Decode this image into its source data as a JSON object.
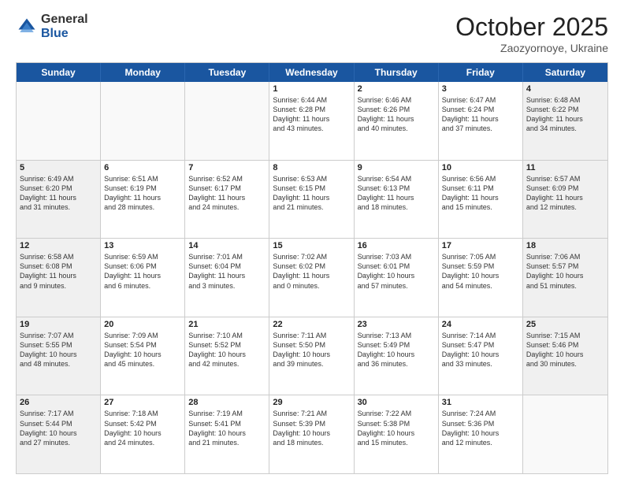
{
  "header": {
    "logo_general": "General",
    "logo_blue": "Blue",
    "month_title": "October 2025",
    "subtitle": "Zaozyornoye, Ukraine"
  },
  "days_of_week": [
    "Sunday",
    "Monday",
    "Tuesday",
    "Wednesday",
    "Thursday",
    "Friday",
    "Saturday"
  ],
  "weeks": [
    [
      {
        "day": "",
        "info": "",
        "empty": true
      },
      {
        "day": "",
        "info": "",
        "empty": true
      },
      {
        "day": "",
        "info": "",
        "empty": true
      },
      {
        "day": "1",
        "info": "Sunrise: 6:44 AM\nSunset: 6:28 PM\nDaylight: 11 hours\nand 43 minutes."
      },
      {
        "day": "2",
        "info": "Sunrise: 6:46 AM\nSunset: 6:26 PM\nDaylight: 11 hours\nand 40 minutes."
      },
      {
        "day": "3",
        "info": "Sunrise: 6:47 AM\nSunset: 6:24 PM\nDaylight: 11 hours\nand 37 minutes."
      },
      {
        "day": "4",
        "info": "Sunrise: 6:48 AM\nSunset: 6:22 PM\nDaylight: 11 hours\nand 34 minutes.",
        "shaded": true
      }
    ],
    [
      {
        "day": "5",
        "info": "Sunrise: 6:49 AM\nSunset: 6:20 PM\nDaylight: 11 hours\nand 31 minutes.",
        "shaded": true
      },
      {
        "day": "6",
        "info": "Sunrise: 6:51 AM\nSunset: 6:19 PM\nDaylight: 11 hours\nand 28 minutes."
      },
      {
        "day": "7",
        "info": "Sunrise: 6:52 AM\nSunset: 6:17 PM\nDaylight: 11 hours\nand 24 minutes."
      },
      {
        "day": "8",
        "info": "Sunrise: 6:53 AM\nSunset: 6:15 PM\nDaylight: 11 hours\nand 21 minutes."
      },
      {
        "day": "9",
        "info": "Sunrise: 6:54 AM\nSunset: 6:13 PM\nDaylight: 11 hours\nand 18 minutes."
      },
      {
        "day": "10",
        "info": "Sunrise: 6:56 AM\nSunset: 6:11 PM\nDaylight: 11 hours\nand 15 minutes."
      },
      {
        "day": "11",
        "info": "Sunrise: 6:57 AM\nSunset: 6:09 PM\nDaylight: 11 hours\nand 12 minutes.",
        "shaded": true
      }
    ],
    [
      {
        "day": "12",
        "info": "Sunrise: 6:58 AM\nSunset: 6:08 PM\nDaylight: 11 hours\nand 9 minutes.",
        "shaded": true
      },
      {
        "day": "13",
        "info": "Sunrise: 6:59 AM\nSunset: 6:06 PM\nDaylight: 11 hours\nand 6 minutes."
      },
      {
        "day": "14",
        "info": "Sunrise: 7:01 AM\nSunset: 6:04 PM\nDaylight: 11 hours\nand 3 minutes."
      },
      {
        "day": "15",
        "info": "Sunrise: 7:02 AM\nSunset: 6:02 PM\nDaylight: 11 hours\nand 0 minutes."
      },
      {
        "day": "16",
        "info": "Sunrise: 7:03 AM\nSunset: 6:01 PM\nDaylight: 10 hours\nand 57 minutes."
      },
      {
        "day": "17",
        "info": "Sunrise: 7:05 AM\nSunset: 5:59 PM\nDaylight: 10 hours\nand 54 minutes."
      },
      {
        "day": "18",
        "info": "Sunrise: 7:06 AM\nSunset: 5:57 PM\nDaylight: 10 hours\nand 51 minutes.",
        "shaded": true
      }
    ],
    [
      {
        "day": "19",
        "info": "Sunrise: 7:07 AM\nSunset: 5:55 PM\nDaylight: 10 hours\nand 48 minutes.",
        "shaded": true
      },
      {
        "day": "20",
        "info": "Sunrise: 7:09 AM\nSunset: 5:54 PM\nDaylight: 10 hours\nand 45 minutes."
      },
      {
        "day": "21",
        "info": "Sunrise: 7:10 AM\nSunset: 5:52 PM\nDaylight: 10 hours\nand 42 minutes."
      },
      {
        "day": "22",
        "info": "Sunrise: 7:11 AM\nSunset: 5:50 PM\nDaylight: 10 hours\nand 39 minutes."
      },
      {
        "day": "23",
        "info": "Sunrise: 7:13 AM\nSunset: 5:49 PM\nDaylight: 10 hours\nand 36 minutes."
      },
      {
        "day": "24",
        "info": "Sunrise: 7:14 AM\nSunset: 5:47 PM\nDaylight: 10 hours\nand 33 minutes."
      },
      {
        "day": "25",
        "info": "Sunrise: 7:15 AM\nSunset: 5:46 PM\nDaylight: 10 hours\nand 30 minutes.",
        "shaded": true
      }
    ],
    [
      {
        "day": "26",
        "info": "Sunrise: 7:17 AM\nSunset: 5:44 PM\nDaylight: 10 hours\nand 27 minutes.",
        "shaded": true
      },
      {
        "day": "27",
        "info": "Sunrise: 7:18 AM\nSunset: 5:42 PM\nDaylight: 10 hours\nand 24 minutes."
      },
      {
        "day": "28",
        "info": "Sunrise: 7:19 AM\nSunset: 5:41 PM\nDaylight: 10 hours\nand 21 minutes."
      },
      {
        "day": "29",
        "info": "Sunrise: 7:21 AM\nSunset: 5:39 PM\nDaylight: 10 hours\nand 18 minutes."
      },
      {
        "day": "30",
        "info": "Sunrise: 7:22 AM\nSunset: 5:38 PM\nDaylight: 10 hours\nand 15 minutes."
      },
      {
        "day": "31",
        "info": "Sunrise: 7:24 AM\nSunset: 5:36 PM\nDaylight: 10 hours\nand 12 minutes."
      },
      {
        "day": "",
        "info": "",
        "empty": true,
        "shaded": true
      }
    ]
  ]
}
